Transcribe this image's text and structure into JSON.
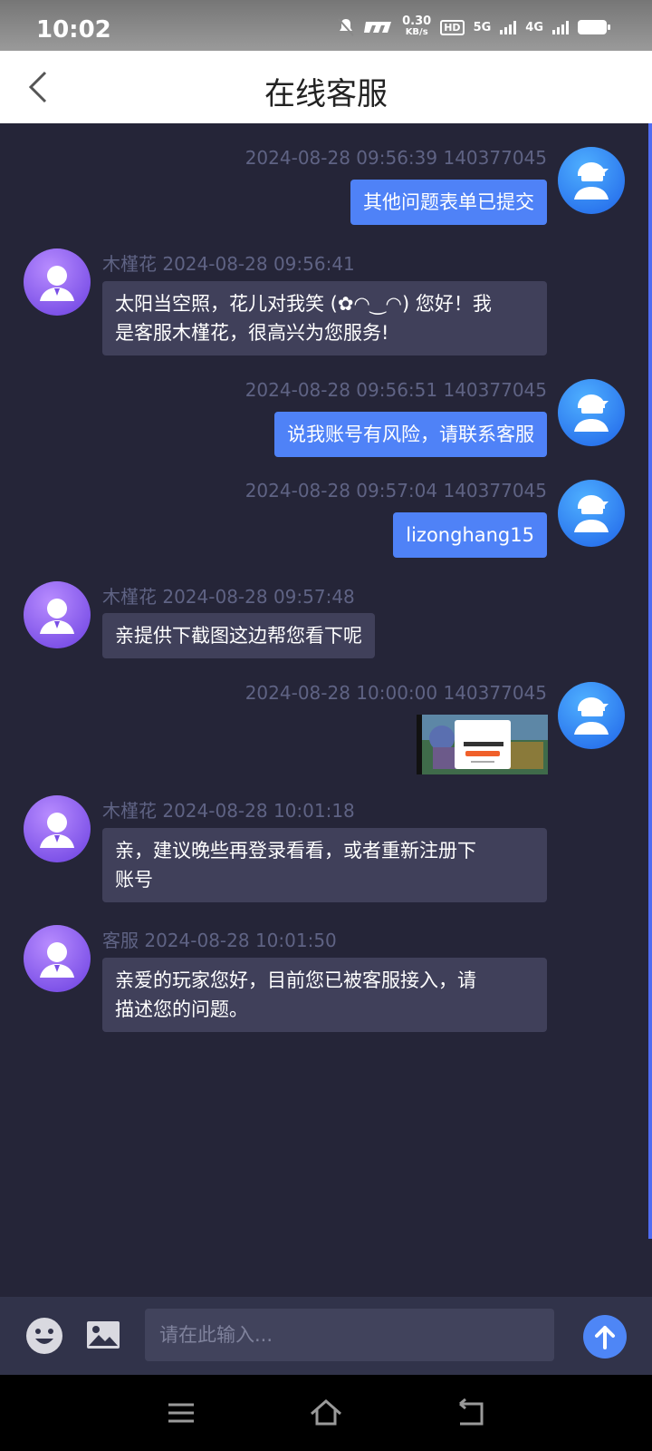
{
  "status_bar": {
    "time": "10:02",
    "net_speed": "0.30",
    "net_unit": "KB/s",
    "hd": "HD",
    "net1": "5G",
    "net2": "4G"
  },
  "header": {
    "title": "在线客服",
    "back_icon": "chevron-left-icon"
  },
  "messages": [
    {
      "side": "user",
      "meta": "2024-08-28 09:56:39 140377045",
      "text": "其他问题表单已提交"
    },
    {
      "side": "agent",
      "sender": "木槿花",
      "time": "2024-08-28 09:56:41",
      "text_lines": [
        "太阳当空照，花儿对我笑 (✿◠‿◠) 您好！我",
        "是客服木槿花，很高兴为您服务!"
      ]
    },
    {
      "side": "user",
      "meta": "2024-08-28 09:56:51 140377045",
      "text": "说我账号有风险，请联系客服"
    },
    {
      "side": "user",
      "meta": "2024-08-28 09:57:04 140377045",
      "text": "lizonghang15"
    },
    {
      "side": "agent",
      "sender": "木槿花",
      "time": "2024-08-28 09:57:48",
      "text": "亲提供下截图这边帮您看下呢"
    },
    {
      "side": "user",
      "meta": "2024-08-28 10:00:00 140377045",
      "type": "image"
    },
    {
      "side": "agent",
      "sender": "木槿花",
      "time": "2024-08-28 10:01:18",
      "text_lines": [
        "亲，建议晚些再登录看看，或者重新注册下",
        "账号"
      ]
    },
    {
      "side": "agent",
      "sender": "客服",
      "time": "2024-08-28 10:01:50",
      "text_lines": [
        "亲爱的玩家您好，目前您已被客服接入，请",
        "描述您的问题。"
      ]
    }
  ],
  "input": {
    "placeholder": "请在此输入...",
    "emoji_icon": "emoji-icon",
    "image_icon": "image-icon",
    "send_icon": "arrow-up-icon"
  },
  "nav": {
    "menu_icon": "menu-icon",
    "home_icon": "home-icon",
    "back_icon": "back-icon"
  },
  "colors": {
    "background": "#252538",
    "user_bubble": "#4f82f7",
    "agent_bubble": "#40405a",
    "accent": "#4e86f6"
  }
}
